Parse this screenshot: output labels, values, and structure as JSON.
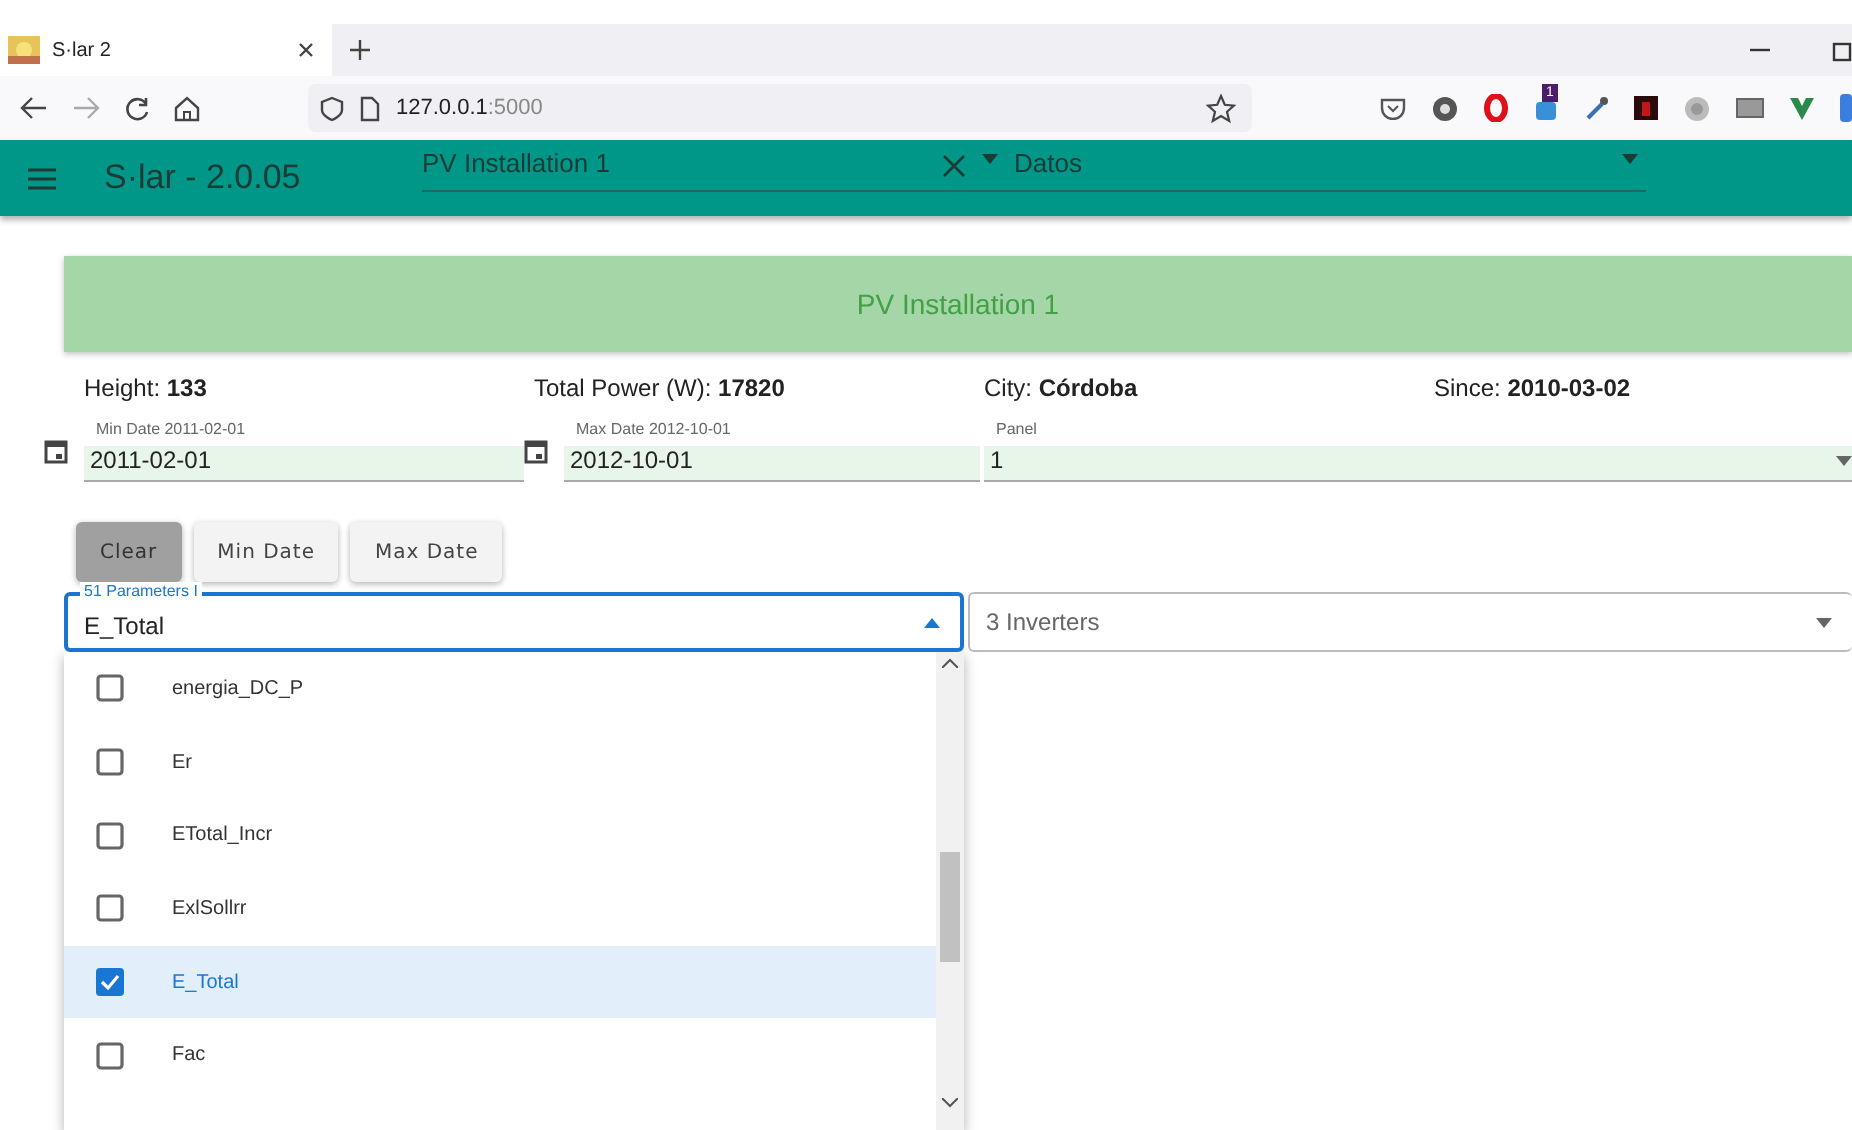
{
  "browser": {
    "tab_title": "S·lar 2",
    "url_host": "127.0.0.1",
    "url_port": ":5000",
    "extension_badge": "1"
  },
  "app_bar": {
    "title": "S·lar - 2.0.05",
    "installation": "PV Installation 1",
    "section": "Datos"
  },
  "banner": {
    "title": "PV Installation 1"
  },
  "info": [
    {
      "label": "Height:",
      "value": "133"
    },
    {
      "label": "Total Power (W):",
      "value": "17820"
    },
    {
      "label": "City:",
      "value": "Córdoba"
    },
    {
      "label": "Since:",
      "value": "2010-03-02"
    }
  ],
  "date_fields": [
    {
      "label": "Min Date 2011-02-01",
      "value": "2011-02-01"
    },
    {
      "label": "Max Date 2012-10-01",
      "value": "2012-10-01"
    }
  ],
  "panel_select": {
    "label": "Panel",
    "value": "1"
  },
  "buttons": [
    {
      "label": "Clear",
      "selected": true
    },
    {
      "label": "Min Date",
      "selected": false
    },
    {
      "label": "Max Date",
      "selected": false
    }
  ],
  "parameters_select": {
    "label": "51 Parameters I",
    "value": "E_Total",
    "expanded": true
  },
  "inverters_select": {
    "value": "3 Inverters"
  },
  "parameter_options": [
    {
      "label": "energia_DC_P",
      "checked": false
    },
    {
      "label": "Er",
      "checked": false
    },
    {
      "label": "ETotal_Incr",
      "checked": false
    },
    {
      "label": "ExlSollrr",
      "checked": false
    },
    {
      "label": "E_Total",
      "checked": true
    },
    {
      "label": "Fac",
      "checked": false
    }
  ]
}
